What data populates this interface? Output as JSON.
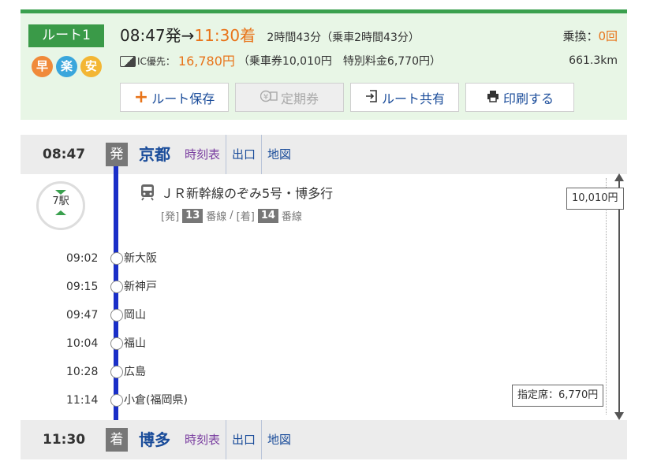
{
  "route": {
    "label": "ルート1",
    "badges": [
      "早",
      "楽",
      "安"
    ],
    "depart_time": "08:47",
    "depart_suffix": "発→",
    "arrive_time": "11:30",
    "arrive_suffix": "着",
    "duration": "2時間43分（乗車2時間43分）",
    "ic_label": "IC優先：",
    "fare_total": "16,780円",
    "fare_detail": "（乗車券10,010円　特別料金6,770円）",
    "transfer_label": "乗換：",
    "transfer_count": "0回",
    "distance": "661.3km",
    "buttons": {
      "save": "ルート保存",
      "pass": "定期券",
      "share": "ルート共有",
      "print": "印刷する"
    }
  },
  "departure": {
    "time": "08:47",
    "tag": "発",
    "station": "京都",
    "links": [
      "時刻表",
      "出口",
      "地図"
    ]
  },
  "train": {
    "stop_count": "7駅",
    "name": "ＪＲ新幹線のぞみ5号・博多行",
    "dep_label": "[発]",
    "dep_platform": "13",
    "arr_label": "[着]",
    "arr_platform": "14",
    "platform_suffix": "番線",
    "separator": "/",
    "stops": [
      {
        "time": "09:02",
        "name": "新大阪"
      },
      {
        "time": "09:15",
        "name": "新神戸"
      },
      {
        "time": "09:47",
        "name": "岡山"
      },
      {
        "time": "10:04",
        "name": "福山"
      },
      {
        "time": "10:28",
        "name": "広島"
      },
      {
        "time": "11:14",
        "name": "小倉(福岡県)"
      }
    ],
    "ticket_fare": "10,010円",
    "reserved_fare": "指定席：6,770円"
  },
  "arrival": {
    "time": "11:30",
    "tag": "着",
    "station": "博多",
    "links": [
      "時刻表",
      "出口",
      "地図"
    ]
  },
  "colors": {
    "accent": "#e8741a",
    "route_green": "#3a9a48",
    "link_blue": "#1a4c9a",
    "line_blue": "#1a2fc8"
  }
}
